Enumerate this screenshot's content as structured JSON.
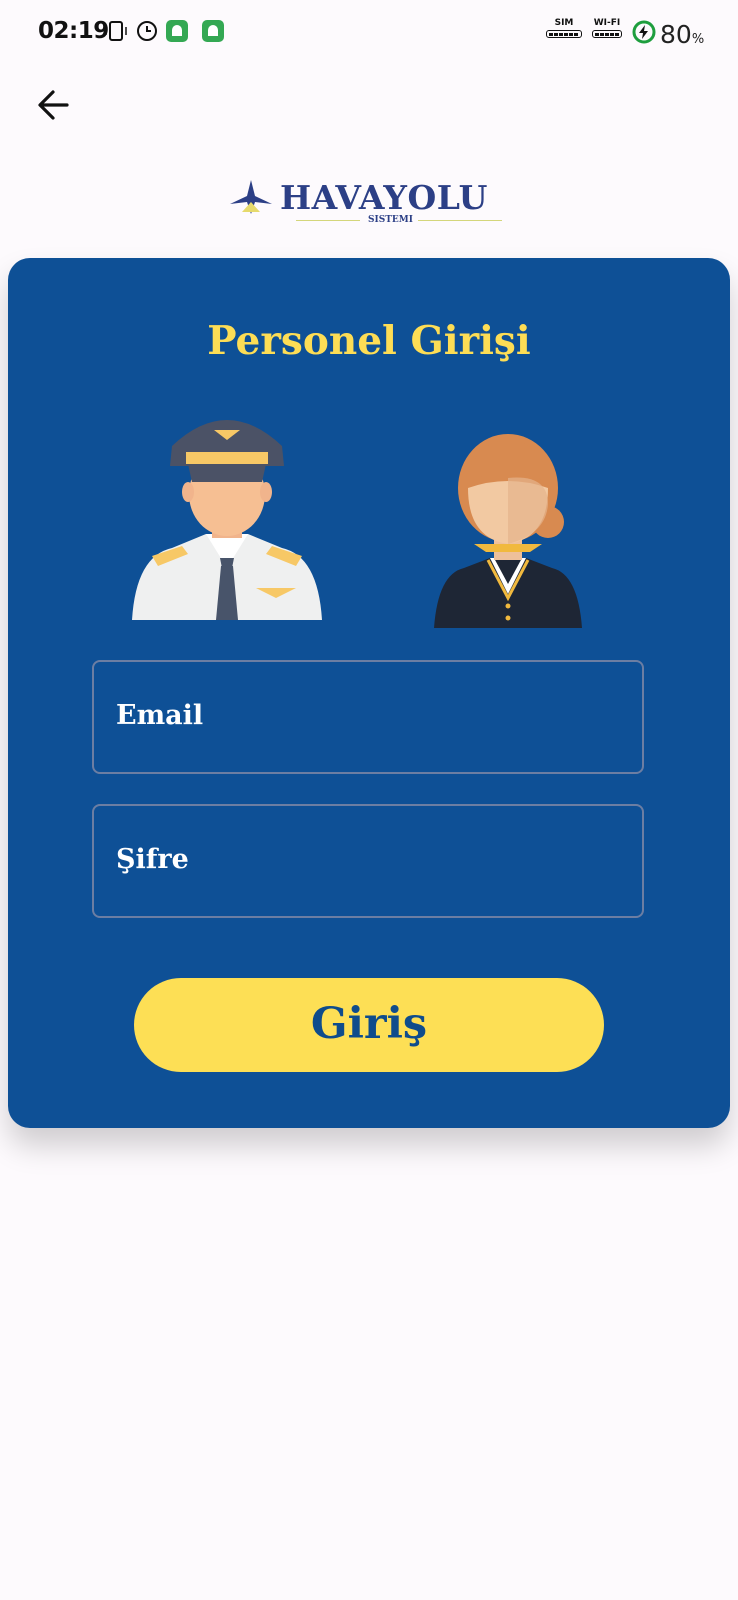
{
  "status_bar": {
    "time": "02:19",
    "sim_label": "SIM",
    "wifi_label": "WI-FI",
    "battery_percent": "80",
    "battery_unit": "%"
  },
  "logo": {
    "wordmark": "HAVAYOLU",
    "subtitle": "SISTEMI"
  },
  "card": {
    "title": "Personel Girişi",
    "email_placeholder": "Email",
    "password_placeholder": "Şifre",
    "login_label": "Giriş"
  },
  "colors": {
    "card_bg": "#0e5096",
    "accent_yellow": "#fddd55",
    "page_bg": "#fdfafd"
  }
}
